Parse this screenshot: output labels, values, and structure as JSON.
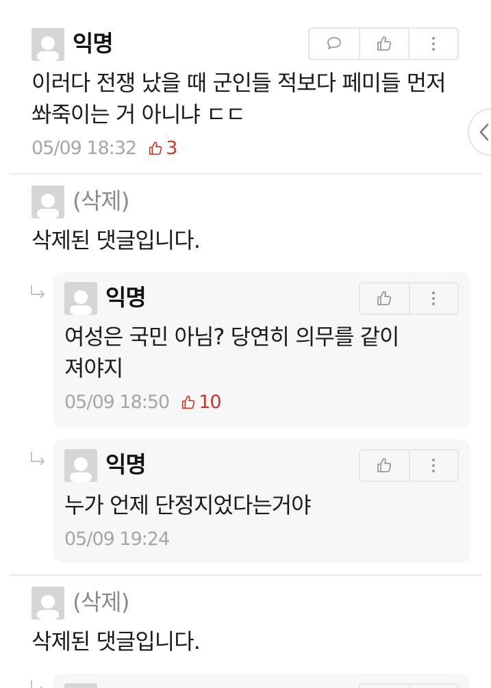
{
  "comments": [
    {
      "nickname": "익명",
      "text": "이러다 전쟁 났을 때 군인들 적보다 페미들 먼저\n쏴죽이는 거 아니냐 ㄷㄷ",
      "time": "05/09 18:32",
      "votes": "3"
    },
    {
      "nickname": "(삭제)",
      "text": "삭제된 댓글입니다."
    },
    {
      "nickname": "(삭제)",
      "text": "삭제된 댓글입니다."
    }
  ],
  "replies": [
    {
      "nickname": "익명",
      "text": "여성은 국민 아님? 당연히 의무를 같이\n져야지",
      "time": "05/09 18:50",
      "votes": "10"
    },
    {
      "nickname": "익명",
      "text": "누가 언제 단정지었다는거야",
      "time": "05/09 19:24"
    }
  ],
  "colors": {
    "vote": "#c0392b",
    "meta": "#a6a6a6",
    "reply_bg": "#f7f7f7",
    "border": "#e6e6e6"
  },
  "icons": {
    "comment": "speech-bubble-icon",
    "like": "thumbs-up-icon",
    "more": "vertical-dots-icon",
    "reply": "reply-arrow-icon",
    "side": "chevron-left-icon"
  }
}
